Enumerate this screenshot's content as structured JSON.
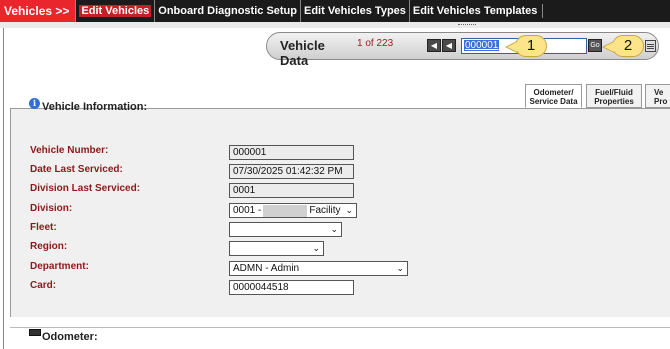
{
  "nav": {
    "brand": "Vehicles >>",
    "items": [
      "Edit Vehicles",
      "Onboard Diagnostic Setup",
      "Edit Vehicles Types",
      "Edit Vehicles Templates"
    ]
  },
  "record_nav": {
    "title": "Vehicle Data",
    "count": "1 of 223",
    "current_value": "000001",
    "go_label": "Go"
  },
  "callouts": [
    "1",
    "2"
  ],
  "tabs": [
    "Odometer/ Service Data",
    "Fuel/Fluid Properties",
    "Ve Pro"
  ],
  "section": {
    "title": "Vehicle Information:"
  },
  "fields": [
    {
      "label": "Vehicle Number:",
      "value": "000001"
    },
    {
      "label": "Date Last Serviced:",
      "value": "07/30/2025 01:42:32 PM"
    },
    {
      "label": "Division Last Serviced:",
      "value": "0001"
    },
    {
      "label": "Division:",
      "value_prefix": "0001 -",
      "value_suffix": "Facility"
    },
    {
      "label": "Fleet:",
      "value": ""
    },
    {
      "label": "Region:",
      "value": ""
    },
    {
      "label": "Department:",
      "value": "ADMN - Admin"
    },
    {
      "label": "Card:",
      "value": "0000044518"
    }
  ],
  "odometer": {
    "title": "Odometer:"
  }
}
